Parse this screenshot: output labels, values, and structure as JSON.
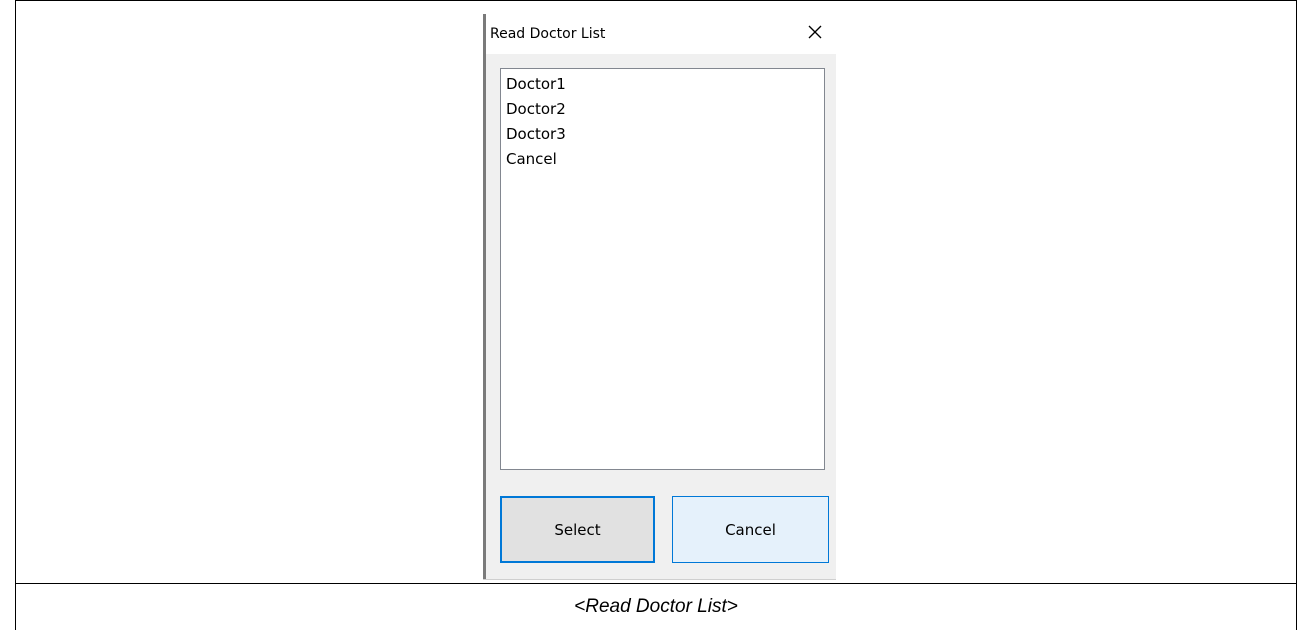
{
  "dialog": {
    "title": "Read Doctor List",
    "close_icon": "close-icon",
    "list_items": [
      "Doctor1",
      "Doctor2",
      "Doctor3",
      "Cancel"
    ],
    "select_label": "Select",
    "cancel_label": "Cancel"
  },
  "caption": "<Read Doctor List>",
  "colors": {
    "accent": "#0078d7",
    "dialog_bg": "#f0f0f0",
    "select_bg": "#e1e1e1",
    "cancel_bg": "#e5f1fb"
  }
}
